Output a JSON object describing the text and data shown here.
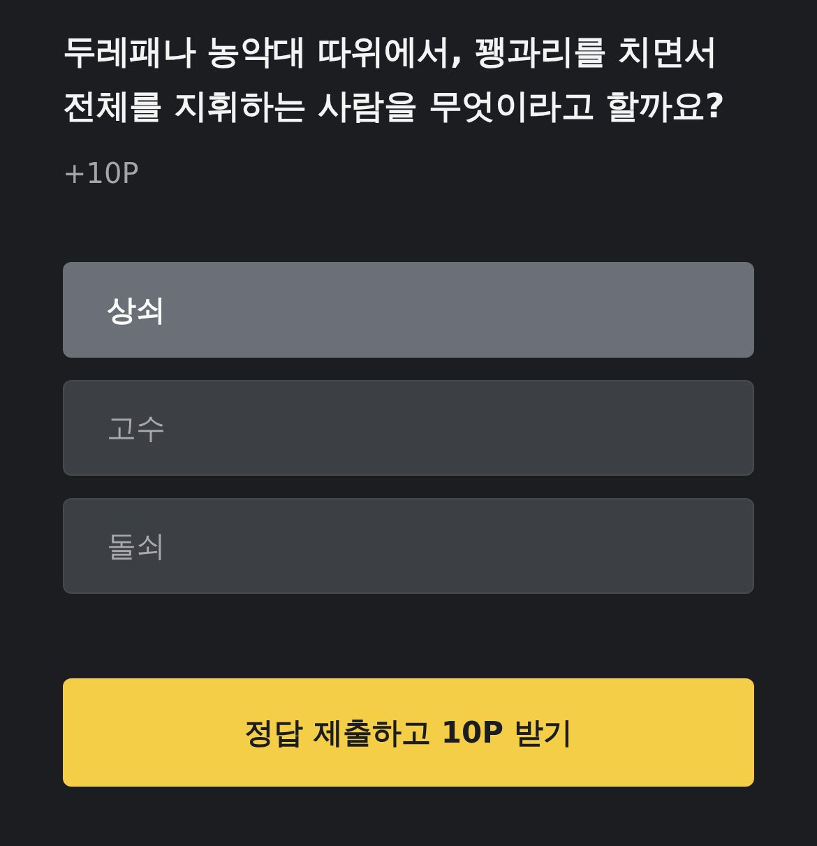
{
  "question": {
    "title": "두레패나 농악대 따위에서, 꽹과리를 치면서 전체를 지휘하는 사람을 무엇이라고 할까요?",
    "reward": "+10P"
  },
  "options": [
    {
      "label": "상쇠",
      "selected": true
    },
    {
      "label": "고수",
      "selected": false
    },
    {
      "label": "돌쇠",
      "selected": false
    }
  ],
  "submit_button": {
    "label": "정답 제출하고 10P 받기"
  }
}
